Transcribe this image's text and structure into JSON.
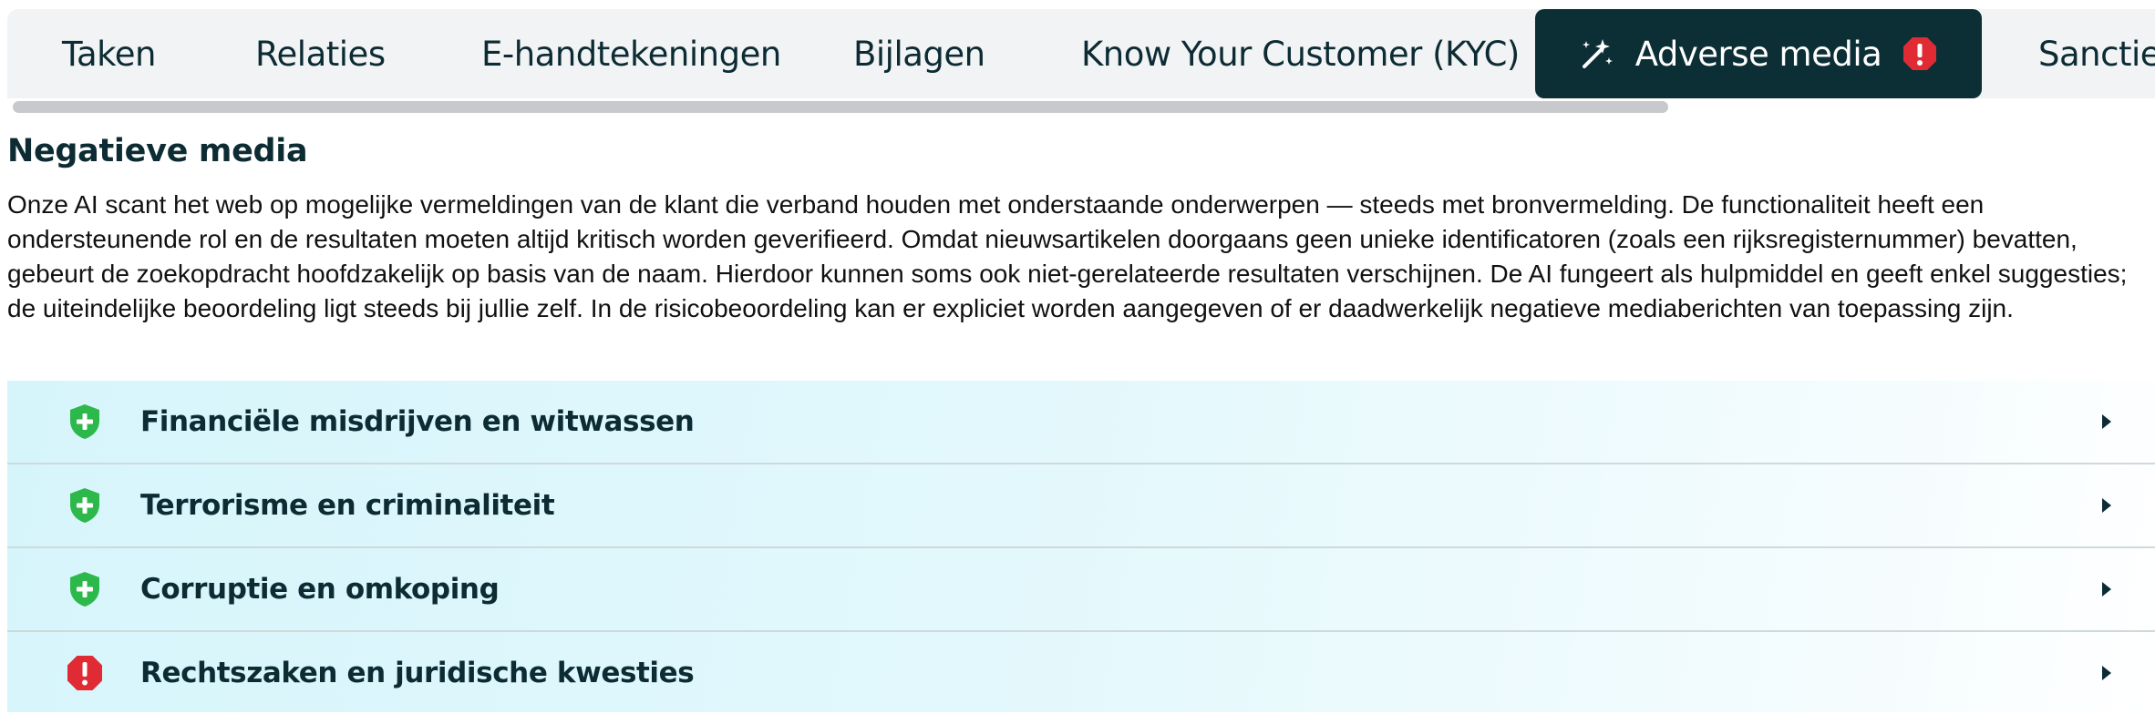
{
  "tabs": [
    {
      "label": "Taken",
      "active": false
    },
    {
      "label": "Relaties",
      "active": false
    },
    {
      "label": "E-handtekeningen",
      "active": false
    },
    {
      "label": "Bijlagen",
      "active": false
    },
    {
      "label": "Know Your Customer (KYC)",
      "active": false
    },
    {
      "label": "Adverse media",
      "active": true,
      "icon": "magic-wand-icon",
      "badge_icon": "alert-octagon-icon"
    },
    {
      "label": "Sancties",
      "active": false
    }
  ],
  "section": {
    "title": "Negatieve media",
    "description": "Onze AI scant het web op mogelijke vermeldingen van de klant die verband houden met onderstaande onderwerpen — steeds met bronvermelding. De functionaliteit heeft een ondersteunende rol en de resultaten moeten altijd kritisch worden geverifieerd. Omdat nieuwsartikelen doorgaans geen unieke identificatoren (zoals een rijksregisternummer) bevatten, gebeurt de zoekopdracht hoofdzakelijk op basis van de naam. Hierdoor kunnen soms ook niet-gerelateerde resultaten verschijnen. De AI fungeert als hulpmiddel en geeft enkel suggesties; de uiteindelijke beoordeling ligt steeds bij jullie zelf. In de risicobeoordeling kan er expliciet worden aangegeven of er daadwerkelijk negatieve mediaberichten van toepassing zijn."
  },
  "categories": [
    {
      "label": "Financiële misdrijven en witwassen",
      "status": "ok",
      "icon": "shield-plus-icon"
    },
    {
      "label": "Terrorisme en criminaliteit",
      "status": "ok",
      "icon": "shield-plus-icon"
    },
    {
      "label": "Corruptie en omkoping",
      "status": "ok",
      "icon": "shield-plus-icon"
    },
    {
      "label": "Rechtszaken en juridische kwesties",
      "status": "alert",
      "icon": "alert-octagon-icon"
    }
  ],
  "colors": {
    "active_tab_bg": "#0c2f36",
    "ok_green": "#2db84b",
    "alert_red": "#e02b35",
    "accordion_bg": "#d6f5fb"
  }
}
